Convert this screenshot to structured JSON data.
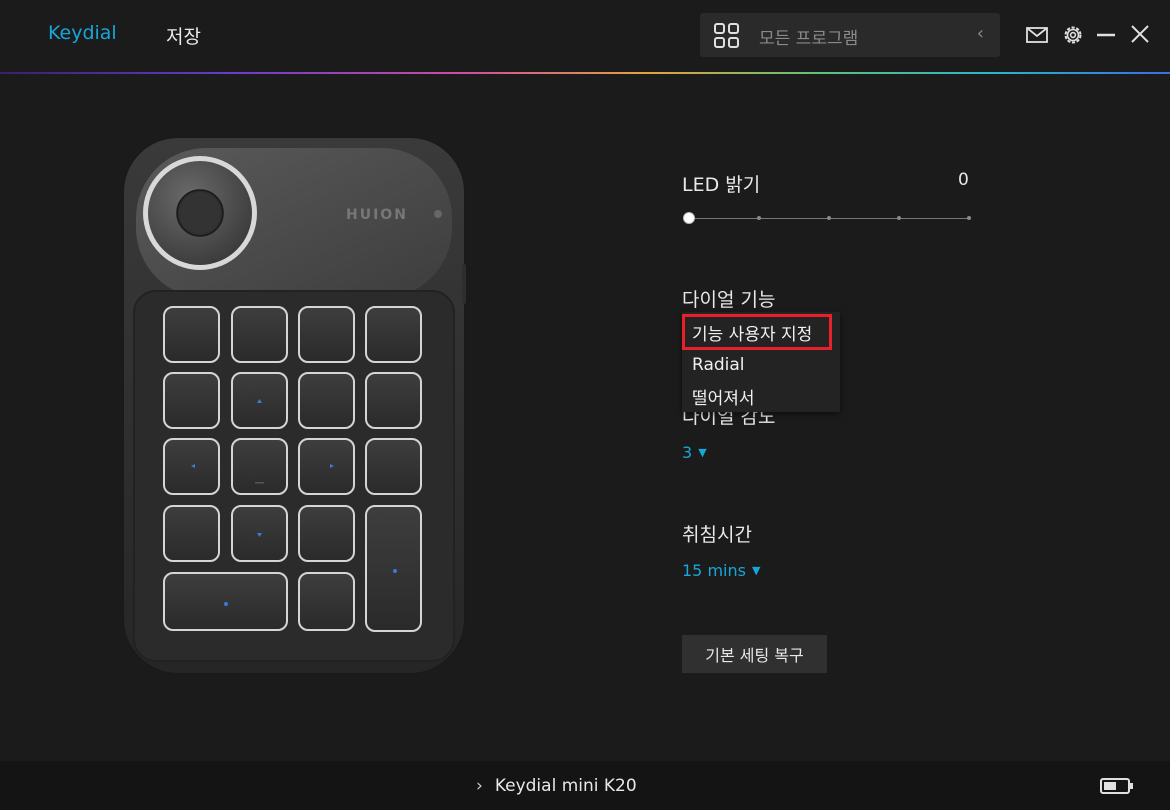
{
  "header": {
    "tabs": [
      {
        "label": "Keydial",
        "active": true
      },
      {
        "label": "저장",
        "active": false
      }
    ],
    "program_selector": {
      "label": "모든 프로그램",
      "icon": "grid-icon"
    },
    "window_icons": [
      "mail-icon",
      "gear-icon",
      "minimize-icon",
      "close-icon"
    ]
  },
  "settings": {
    "led": {
      "label": "LED 밝기",
      "value": "0"
    },
    "dial_function": {
      "label": "다이얼 기능",
      "options": [
        "기능 사용자 지정",
        "Radial",
        "떨어져서"
      ],
      "highlighted_index": 0
    },
    "dial_sensitivity": {
      "label": "다이얼 감도",
      "value": "3"
    },
    "sleep_time": {
      "label": "취침시간",
      "value": "15 mins"
    },
    "reset_button": "기본 세팅 복구"
  },
  "device_image": {
    "brand": "HUION"
  },
  "footer": {
    "device_name": "Keydial mini K20",
    "battery_icon": "battery-icon"
  },
  "colors": {
    "accent": "#17a6d9",
    "highlight": "#e8202a",
    "background": "#1b1b1b"
  }
}
